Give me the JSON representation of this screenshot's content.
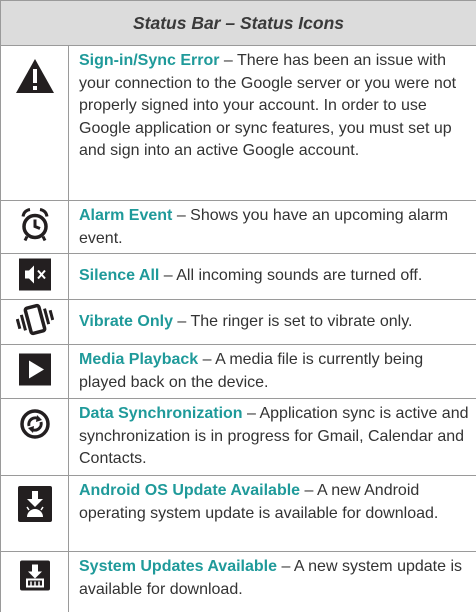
{
  "header": "Status Bar – Status Icons",
  "dash": " – ",
  "rows": [
    {
      "icon": "warning-triangle-icon",
      "title": "Sign-in/Sync Error",
      "desc": "There has been an issue with your connection to the Google server or you were not properly signed into your account. In order to use Google application or sync features, you must set up and sign into an active Google account."
    },
    {
      "icon": "alarm-clock-icon",
      "title": "Alarm Event",
      "desc": "Shows you have an upcoming alarm event."
    },
    {
      "icon": "silence-speaker-icon",
      "title": "Silence All",
      "desc": "All incoming sounds are turned off."
    },
    {
      "icon": "vibrate-phone-icon",
      "title": "Vibrate Only",
      "desc": "The ringer is set to vibrate only."
    },
    {
      "icon": "play-icon",
      "title": "Media Playback",
      "desc": "A media file is currently being played back on the device."
    },
    {
      "icon": "sync-icon",
      "title": "Data Synchronization",
      "desc": "Application sync is active and synchronization is in progress for Gmail, Calendar and Contacts."
    },
    {
      "icon": "android-update-icon",
      "title": "Android OS Update Available",
      "desc": "A new Android operating system update is available for download."
    },
    {
      "icon": "system-update-icon",
      "title": "System Updates Available",
      "desc": "A new system update is available for download."
    }
  ],
  "colors": {
    "title": "#1f9a9a",
    "header_bg": "#dcdcdc",
    "border": "#9a9a9a",
    "icon": "#231f20"
  }
}
